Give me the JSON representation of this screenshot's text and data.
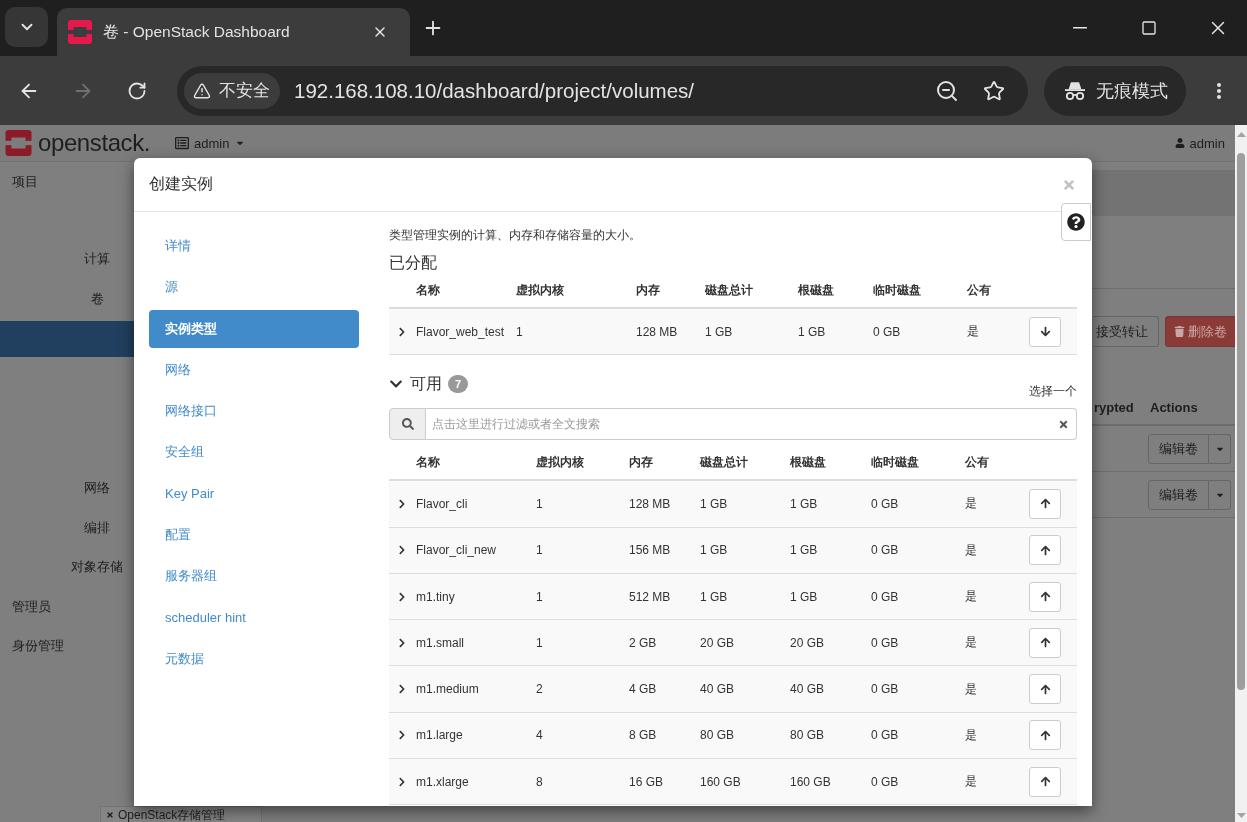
{
  "browser": {
    "tab_title": "卷 - OpenStack Dashboard",
    "forward_disabled": true,
    "security_label": "不安全",
    "url": "192.168.108.10/dashboard/project/volumes/",
    "incognito_label": "无痕模式"
  },
  "page": {
    "logo_text": "openstack.",
    "project_menu": "admin",
    "user_menu": "admin",
    "sidebar": [
      {
        "label": "项目",
        "kind": "section",
        "selected": false
      },
      {
        "label": "计算",
        "kind": "group",
        "selected": false
      },
      {
        "label": "卷",
        "kind": "group",
        "selected": false
      },
      {
        "kind": "item",
        "selected": true
      },
      {
        "label": "网络",
        "kind": "group",
        "selected": false
      },
      {
        "label": "编排",
        "kind": "group",
        "selected": false
      },
      {
        "label": "对象存储",
        "kind": "group",
        "selected": false
      },
      {
        "label": "管理员",
        "kind": "section",
        "selected": false
      },
      {
        "label": "身份管理",
        "kind": "section",
        "selected": false
      }
    ],
    "actions": [
      {
        "label": "接受转让",
        "kind": "default"
      },
      {
        "label": "删除卷",
        "kind": "danger"
      }
    ],
    "table": {
      "columns": [
        "rypted",
        "Actions"
      ],
      "rows": [
        {
          "action": "编辑卷"
        },
        {
          "action": "编辑卷"
        }
      ]
    },
    "bottom_tab": "OpenStack存储管理"
  },
  "modal": {
    "title": "创建实例",
    "steps": [
      {
        "label": "详情",
        "selected": false
      },
      {
        "label": "源",
        "selected": false
      },
      {
        "label": "实例类型",
        "selected": true
      },
      {
        "label": "网络",
        "selected": false
      },
      {
        "label": "网络接口",
        "selected": false
      },
      {
        "label": "安全组",
        "selected": false
      },
      {
        "label": "Key Pair",
        "selected": false
      },
      {
        "label": "配置",
        "selected": false
      },
      {
        "label": "服务器组",
        "selected": false
      },
      {
        "label": "scheduler hint",
        "selected": false
      },
      {
        "label": "元数据",
        "selected": false
      }
    ],
    "description": "类型管理实例的计算、内存和存储容量的大小。",
    "allocated": {
      "heading": "已分配",
      "columns": [
        "名称",
        "虚拟内核",
        "内存",
        "磁盘总计",
        "根磁盘",
        "临时磁盘",
        "公有"
      ],
      "rows": [
        {
          "name": "Flavor_web_test",
          "vcpus": "1",
          "ram": "128 MB",
          "total_disk": "1 GB",
          "root_disk": "1 GB",
          "ephemeral_disk": "0 GB",
          "public": "是",
          "expanded": false
        }
      ]
    },
    "available": {
      "heading": "可用",
      "expanded": true,
      "count": "7",
      "hint": "选择一个",
      "search": {
        "placeholder": "点击这里进行过滤或者全文搜索"
      },
      "columns": [
        "名称",
        "虚拟内核",
        "内存",
        "磁盘总计",
        "根磁盘",
        "临时磁盘",
        "公有"
      ],
      "rows": [
        {
          "name": "Flavor_cli",
          "vcpus": "1",
          "ram": "128 MB",
          "total_disk": "1 GB",
          "root_disk": "1 GB",
          "ephemeral_disk": "0 GB",
          "public": "是",
          "expanded": false
        },
        {
          "name": "Flavor_cli_new",
          "vcpus": "1",
          "ram": "156 MB",
          "total_disk": "1 GB",
          "root_disk": "1 GB",
          "ephemeral_disk": "0 GB",
          "public": "是",
          "expanded": false
        },
        {
          "name": "m1.tiny",
          "vcpus": "1",
          "ram": "512 MB",
          "total_disk": "1 GB",
          "root_disk": "1 GB",
          "ephemeral_disk": "0 GB",
          "public": "是",
          "expanded": false
        },
        {
          "name": "m1.small",
          "vcpus": "1",
          "ram": "2 GB",
          "total_disk": "20 GB",
          "root_disk": "20 GB",
          "ephemeral_disk": "0 GB",
          "public": "是",
          "expanded": false
        },
        {
          "name": "m1.medium",
          "vcpus": "2",
          "ram": "4 GB",
          "total_disk": "40 GB",
          "root_disk": "40 GB",
          "ephemeral_disk": "0 GB",
          "public": "是",
          "expanded": false
        },
        {
          "name": "m1.large",
          "vcpus": "4",
          "ram": "8 GB",
          "total_disk": "80 GB",
          "root_disk": "80 GB",
          "ephemeral_disk": "0 GB",
          "public": "是",
          "expanded": false
        },
        {
          "name": "m1.xlarge",
          "vcpus": "8",
          "ram": "16 GB",
          "total_disk": "160 GB",
          "root_disk": "160 GB",
          "ephemeral_disk": "0 GB",
          "public": "是",
          "expanded": false
        }
      ]
    }
  }
}
